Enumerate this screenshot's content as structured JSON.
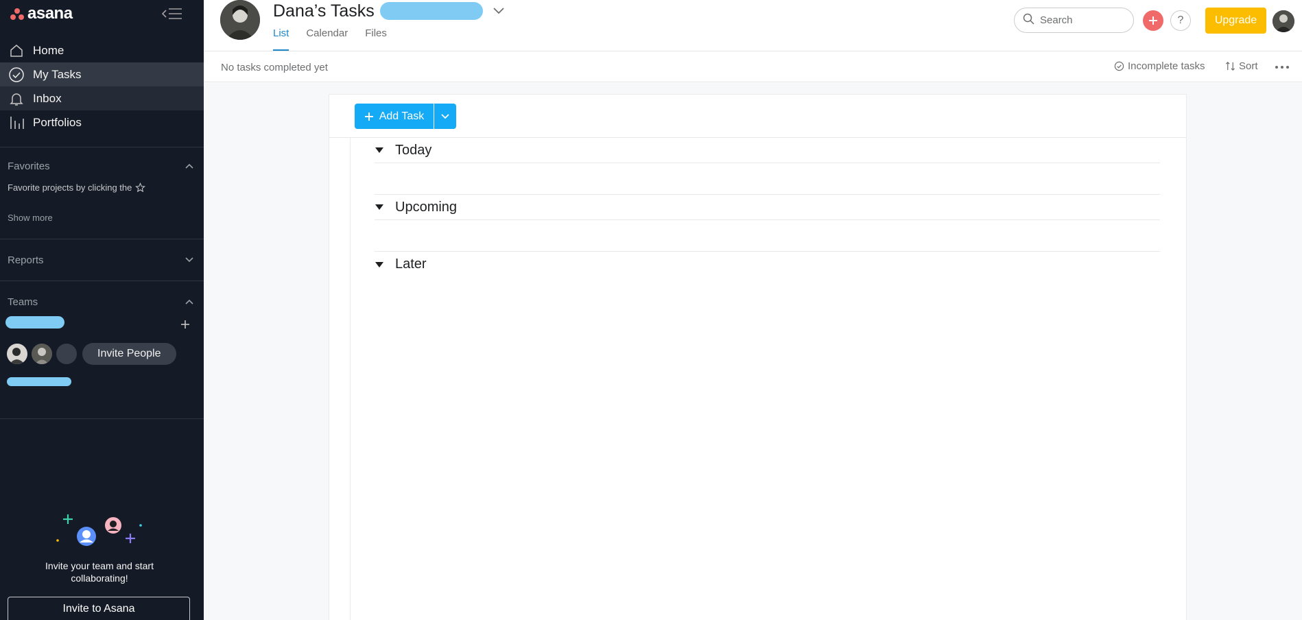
{
  "app": {
    "brand": "asana",
    "colors": {
      "sidebar_bg": "#151b26",
      "accent": "#14aaf5",
      "brand_coral": "#f06a6a",
      "upgrade": "#fcbd01",
      "redaction": "#7fcbf3"
    }
  },
  "sidebar": {
    "nav": [
      {
        "label": "Home",
        "icon": "home-icon"
      },
      {
        "label": "My Tasks",
        "icon": "check-circle-icon"
      },
      {
        "label": "Inbox",
        "icon": "bell-icon"
      },
      {
        "label": "Portfolios",
        "icon": "bar-chart-icon"
      }
    ],
    "favorites": {
      "title": "Favorites",
      "hint": "Favorite projects by clicking the",
      "show_more": "Show more"
    },
    "reports": {
      "title": "Reports"
    },
    "teams": {
      "title": "Teams",
      "invite_people": "Invite People"
    },
    "promo": {
      "text": "Invite your team and start collaborating!",
      "button": "Invite to Asana"
    }
  },
  "header": {
    "title": "Dana’s Tasks",
    "tabs": [
      {
        "label": "List",
        "active": true
      },
      {
        "label": "Calendar",
        "active": false
      },
      {
        "label": "Files",
        "active": false
      }
    ],
    "search_placeholder": "Search",
    "help": "?",
    "upgrade": "Upgrade"
  },
  "subheader": {
    "completed_note": "No tasks completed yet",
    "filter": "Incomplete tasks",
    "sort": "Sort"
  },
  "main": {
    "add_task": "Add Task",
    "sections": [
      {
        "label": "Today"
      },
      {
        "label": "Upcoming"
      },
      {
        "label": "Later"
      }
    ]
  }
}
